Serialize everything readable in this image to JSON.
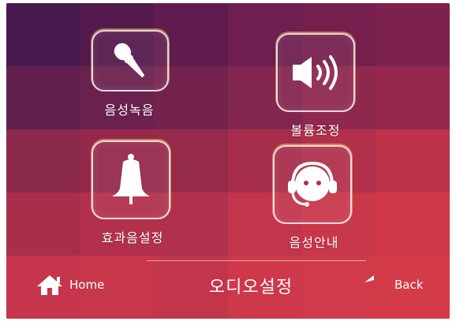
{
  "menu": {
    "items": [
      {
        "label": "음성녹음",
        "icon": "microphone-icon"
      },
      {
        "label": "볼륨조정",
        "icon": "speaker-volume-icon"
      },
      {
        "label": "효과음설정",
        "icon": "bell-icon"
      },
      {
        "label": "음성안내",
        "icon": "headset-icon"
      }
    ]
  },
  "bottom_bar": {
    "title": "오디오설정",
    "home_label": "Home",
    "back_label": "Back",
    "home_icon": "home-icon",
    "back_icon": "back-arrow-icon"
  },
  "theme": {
    "background": "#8a2a4c",
    "button_border": "#ffffff",
    "button_glow": "#ffc850"
  }
}
